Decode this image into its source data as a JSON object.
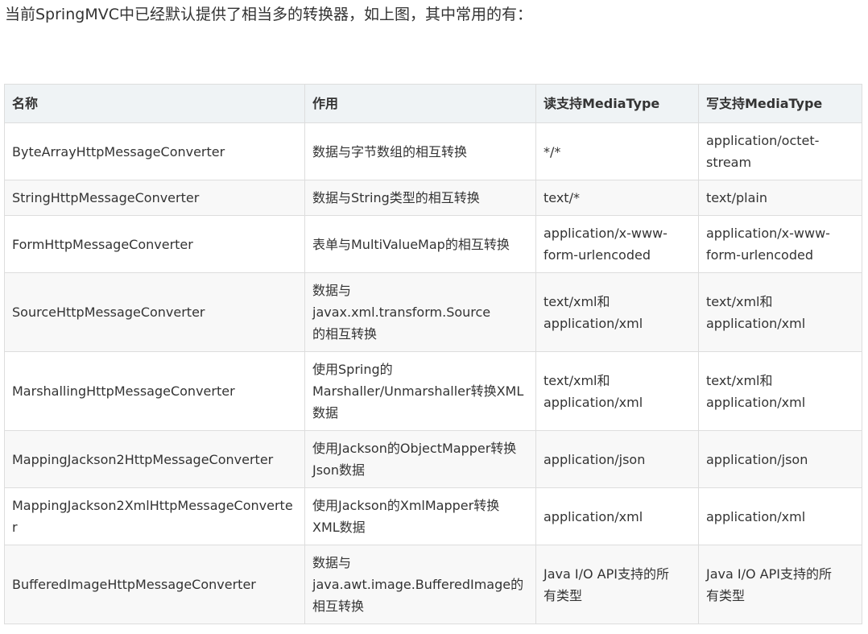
{
  "intro_text": "当前SpringMVC中已经默认提供了相当多的转换器，如上图，其中常用的有：",
  "table": {
    "headers": {
      "name": "名称",
      "role": "作用",
      "read": "读支持MediaType",
      "write": "写支持MediaType"
    },
    "rows": [
      {
        "name": "ByteArrayHttpMessageConverter",
        "role": "数据与字节数组的相互转换",
        "read": "*/*",
        "write": "application/octet-\nstream"
      },
      {
        "name": "StringHttpMessageConverter",
        "role": "数据与String类型的相互转换",
        "read": "text/*",
        "write": "text/plain"
      },
      {
        "name": "FormHttpMessageConverter",
        "role": "表单与MultiValueMap的相互转换",
        "read": "application/x-www-\nform-urlencoded",
        "write": "application/x-www-\nform-urlencoded"
      },
      {
        "name": "SourceHttpMessageConverter",
        "role": "数据与javax.xml.transform.Source\n的相互转换",
        "read": "text/xml和\napplication/xml",
        "write": "text/xml和\napplication/xml"
      },
      {
        "name": "MarshallingHttpMessageConverter",
        "role": "使用Spring的\nMarshaller/Unmarshaller转换XML\n数据",
        "read": "text/xml和\napplication/xml",
        "write": "text/xml和\napplication/xml"
      },
      {
        "name": "MappingJackson2HttpMessageConverter",
        "role": "使用Jackson的ObjectMapper转换\nJson数据",
        "read": "application/json",
        "write": "application/json"
      },
      {
        "name": "MappingJackson2XmlHttpMessageConverter",
        "role": "使用Jackson的XmlMapper转换\nXML数据",
        "read": "application/xml",
        "write": "application/xml"
      },
      {
        "name": "BufferedImageHttpMessageConverter",
        "role": "数据与\njava.awt.image.BufferedImage的\n相互转换",
        "read": "Java I/O API支持的所\n有类型",
        "write": "Java I/O API支持的所\n有类型"
      }
    ]
  }
}
